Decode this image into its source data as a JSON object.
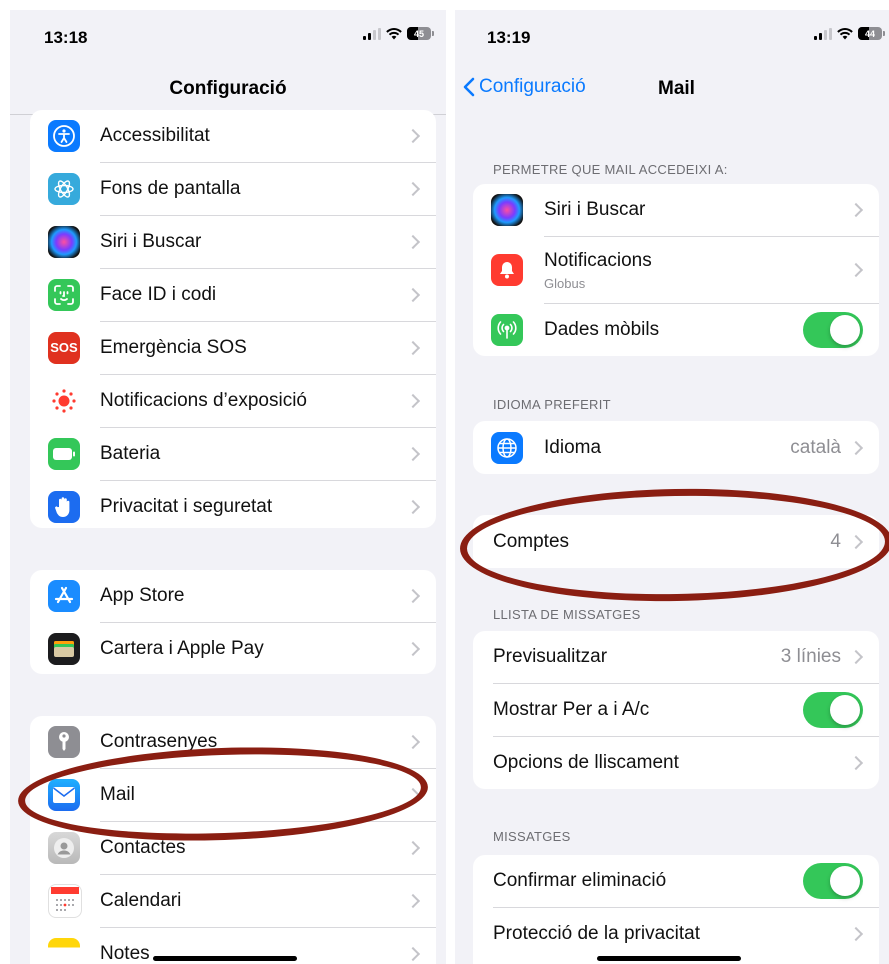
{
  "left": {
    "time": "13:18",
    "battery": "45",
    "title": "Configuració",
    "groups": [
      [
        {
          "label": "Accessibilitat",
          "icon": "accessibility-icon",
          "color": "#0a7aff"
        },
        {
          "label": "Fons de pantalla",
          "icon": "wallpaper-icon",
          "color": "#36aadc"
        },
        {
          "label": "Siri i Buscar",
          "icon": "siri-icon",
          "color": "#222222"
        },
        {
          "label": "Face ID i codi",
          "icon": "faceid-icon",
          "color": "#34c759"
        },
        {
          "label": "Emergència SOS",
          "icon": "sos-icon",
          "color": "#e0311f",
          "glyph": "SOS"
        },
        {
          "label": "Notificacions d’exposició",
          "icon": "exposure-icon",
          "color": "#ffffff"
        },
        {
          "label": "Bateria",
          "icon": "battery-icon",
          "color": "#34c759"
        },
        {
          "label": "Privacitat i seguretat",
          "icon": "hand-icon",
          "color": "#1c6cf0"
        }
      ],
      [
        {
          "label": "App Store",
          "icon": "appstore-icon",
          "color": "#1a8cff"
        },
        {
          "label": "Cartera i Apple Pay",
          "icon": "wallet-icon",
          "color": "#1c1c1e"
        }
      ],
      [
        {
          "label": "Contrasenyes",
          "icon": "key-icon",
          "color": "#8e8e93"
        },
        {
          "label": "Mail",
          "icon": "mail-icon",
          "color": "#2f8cf5"
        },
        {
          "label": "Contactes",
          "icon": "contacts-icon",
          "color": "#c9c9c9"
        },
        {
          "label": "Calendari",
          "icon": "calendar-icon",
          "color": "#ffffff"
        },
        {
          "label": "Notes",
          "icon": "notes-icon",
          "color": "#ffd60a"
        }
      ]
    ]
  },
  "right": {
    "time": "13:19",
    "battery": "44",
    "back_label": "Configuració",
    "title": "Mail",
    "sections": {
      "allow": "PERMETRE QUE MAIL ACCEDEIXI A:",
      "language": "IDIOMA PREFERIT",
      "list": "LLISTA DE MISSATGES",
      "messages": "MISSATGES"
    },
    "allow_rows": {
      "siri": "Siri i Buscar",
      "notifications": "Notificacions",
      "notifications_sub": "Globus",
      "cellular": "Dades mòbils"
    },
    "language_row": {
      "label": "Idioma",
      "value": "català"
    },
    "accounts_row": {
      "label": "Comptes",
      "value": "4"
    },
    "list_rows": {
      "preview": "Previsualitzar",
      "preview_value": "3 línies",
      "show_to_cc": "Mostrar Per a i A/c",
      "swipe": "Opcions de lliscament"
    },
    "message_rows": {
      "confirm_delete": "Confirmar eliminació",
      "privacy": "Protecció de la privacitat"
    }
  },
  "colors": {
    "accent": "#0a7aff",
    "toggle_on": "#34c759",
    "annotation": "#8a1e12"
  }
}
